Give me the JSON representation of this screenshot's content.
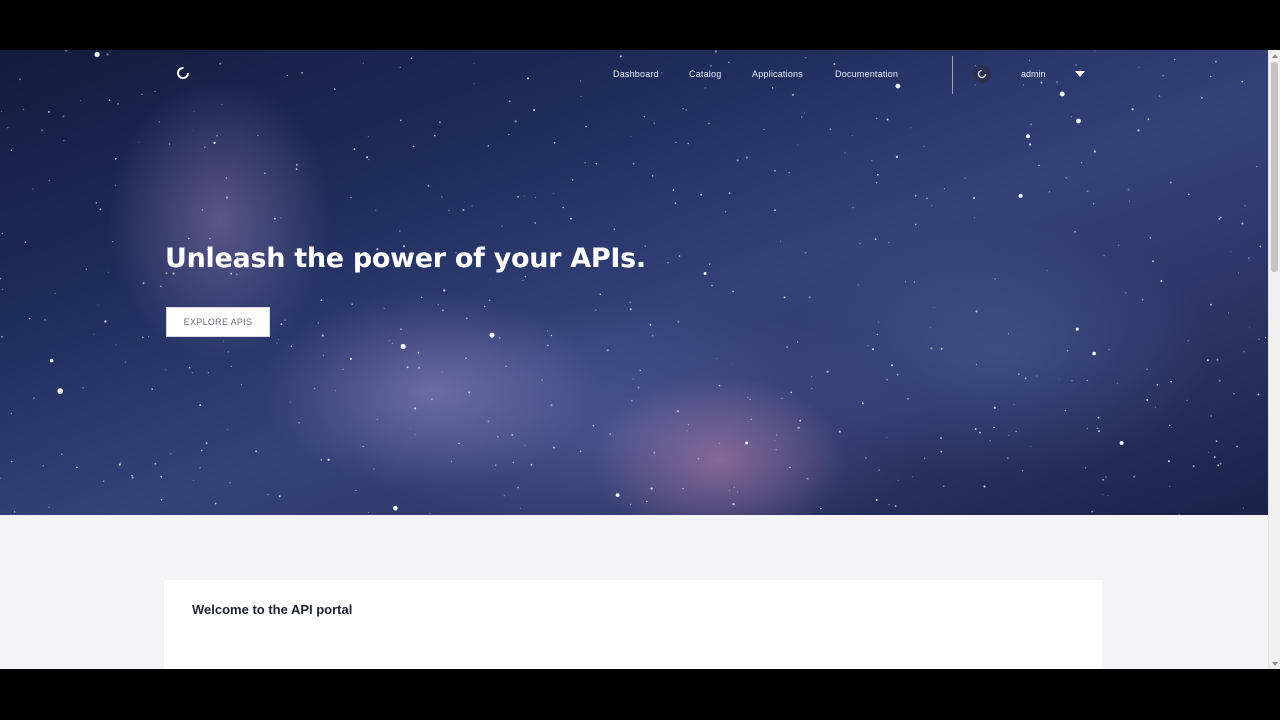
{
  "nav": {
    "links": [
      "Dashboard",
      "Catalog",
      "Applications",
      "Documentation"
    ],
    "user": "admin"
  },
  "hero": {
    "title": "Unleash the power of your APIs.",
    "cta_label": "EXPLORE APIS"
  },
  "welcome": {
    "title": "Welcome to the API portal"
  },
  "icons": {
    "logo": "portal-logo-icon",
    "avatar": "user-avatar-icon",
    "dropdown": "caret-down-icon"
  },
  "colors": {
    "hero_sky": "#1f2d5c",
    "page_background": "#f4f4f6",
    "card_background": "#ffffff",
    "text_light": "#e8ebf5"
  }
}
